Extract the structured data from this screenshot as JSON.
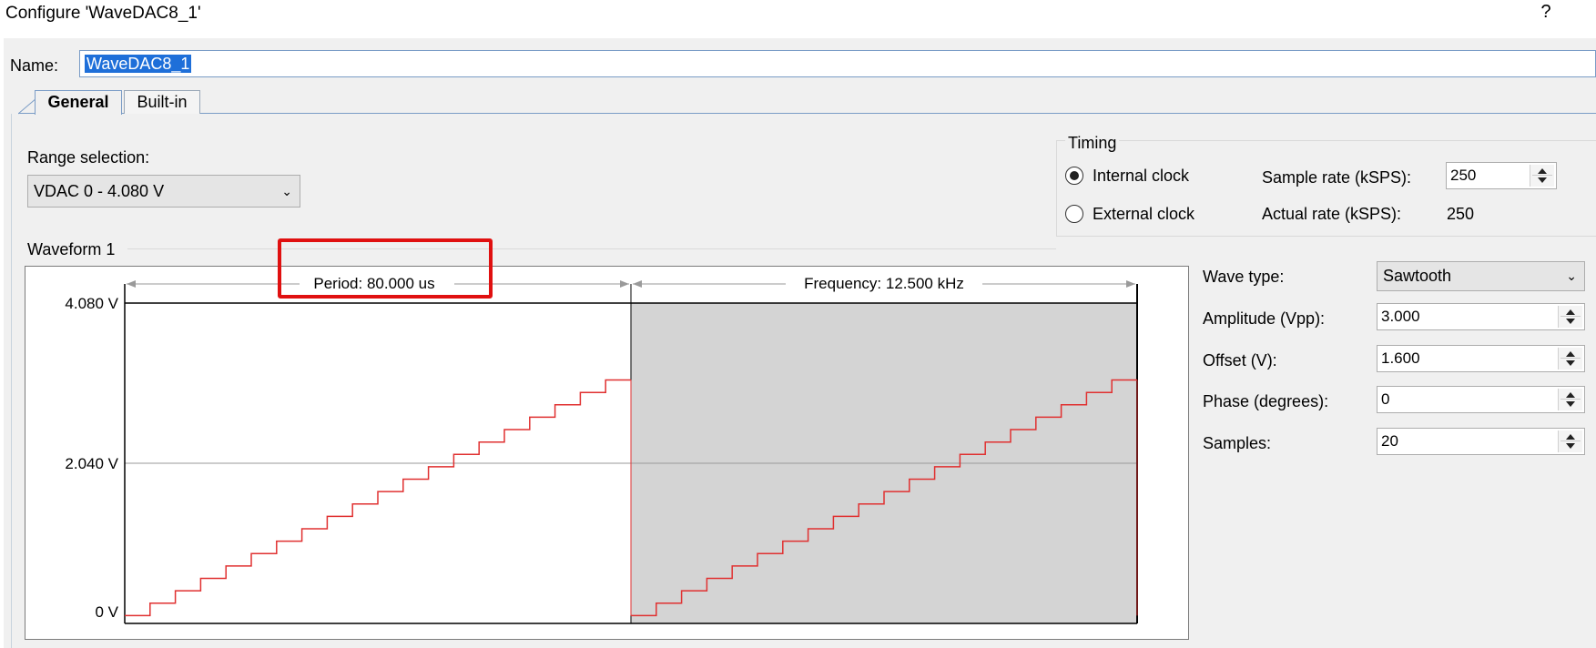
{
  "window": {
    "title": "Configure 'WaveDAC8_1'",
    "help": "?"
  },
  "name": {
    "label": "Name:",
    "value": "WaveDAC8_1"
  },
  "tabs": [
    {
      "label": "General"
    },
    {
      "label": "Built-in"
    }
  ],
  "range": {
    "label": "Range selection:",
    "value": "VDAC 0 - 4.080 V"
  },
  "timing": {
    "title": "Timing",
    "internal_clock": "Internal clock",
    "external_clock": "External clock",
    "selected": "Internal clock",
    "sample_rate_label": "Sample rate (kSPS):",
    "sample_rate_value": "250",
    "actual_rate_label": "Actual rate (kSPS):",
    "actual_rate_value": "250"
  },
  "waveform": {
    "title": "Waveform 1",
    "period_text": "Period: 80.000 us",
    "frequency_text": "Frequency: 12.500 kHz",
    "y_labels": [
      "4.080 V",
      "2.040 V",
      "0 V"
    ]
  },
  "properties": {
    "wave_type_label": "Wave type:",
    "wave_type_value": "Sawtooth",
    "amplitude_label": "Amplitude (Vpp):",
    "amplitude_value": "3.000",
    "offset_label": "Offset (V):",
    "offset_value": "1.600",
    "phase_label": "Phase (degrees):",
    "phase_value": "0",
    "samples_label": "Samples:",
    "samples_value": "20"
  },
  "chart_data": {
    "type": "line",
    "ylim": [
      0,
      4.08
    ],
    "yticks": [
      "4.080 V",
      "2.040 V",
      "0 V"
    ],
    "periods": 2,
    "samples_per_period": 20,
    "min": 0.1,
    "max": 3.1,
    "series": [
      {
        "color": "#e03030"
      }
    ]
  }
}
